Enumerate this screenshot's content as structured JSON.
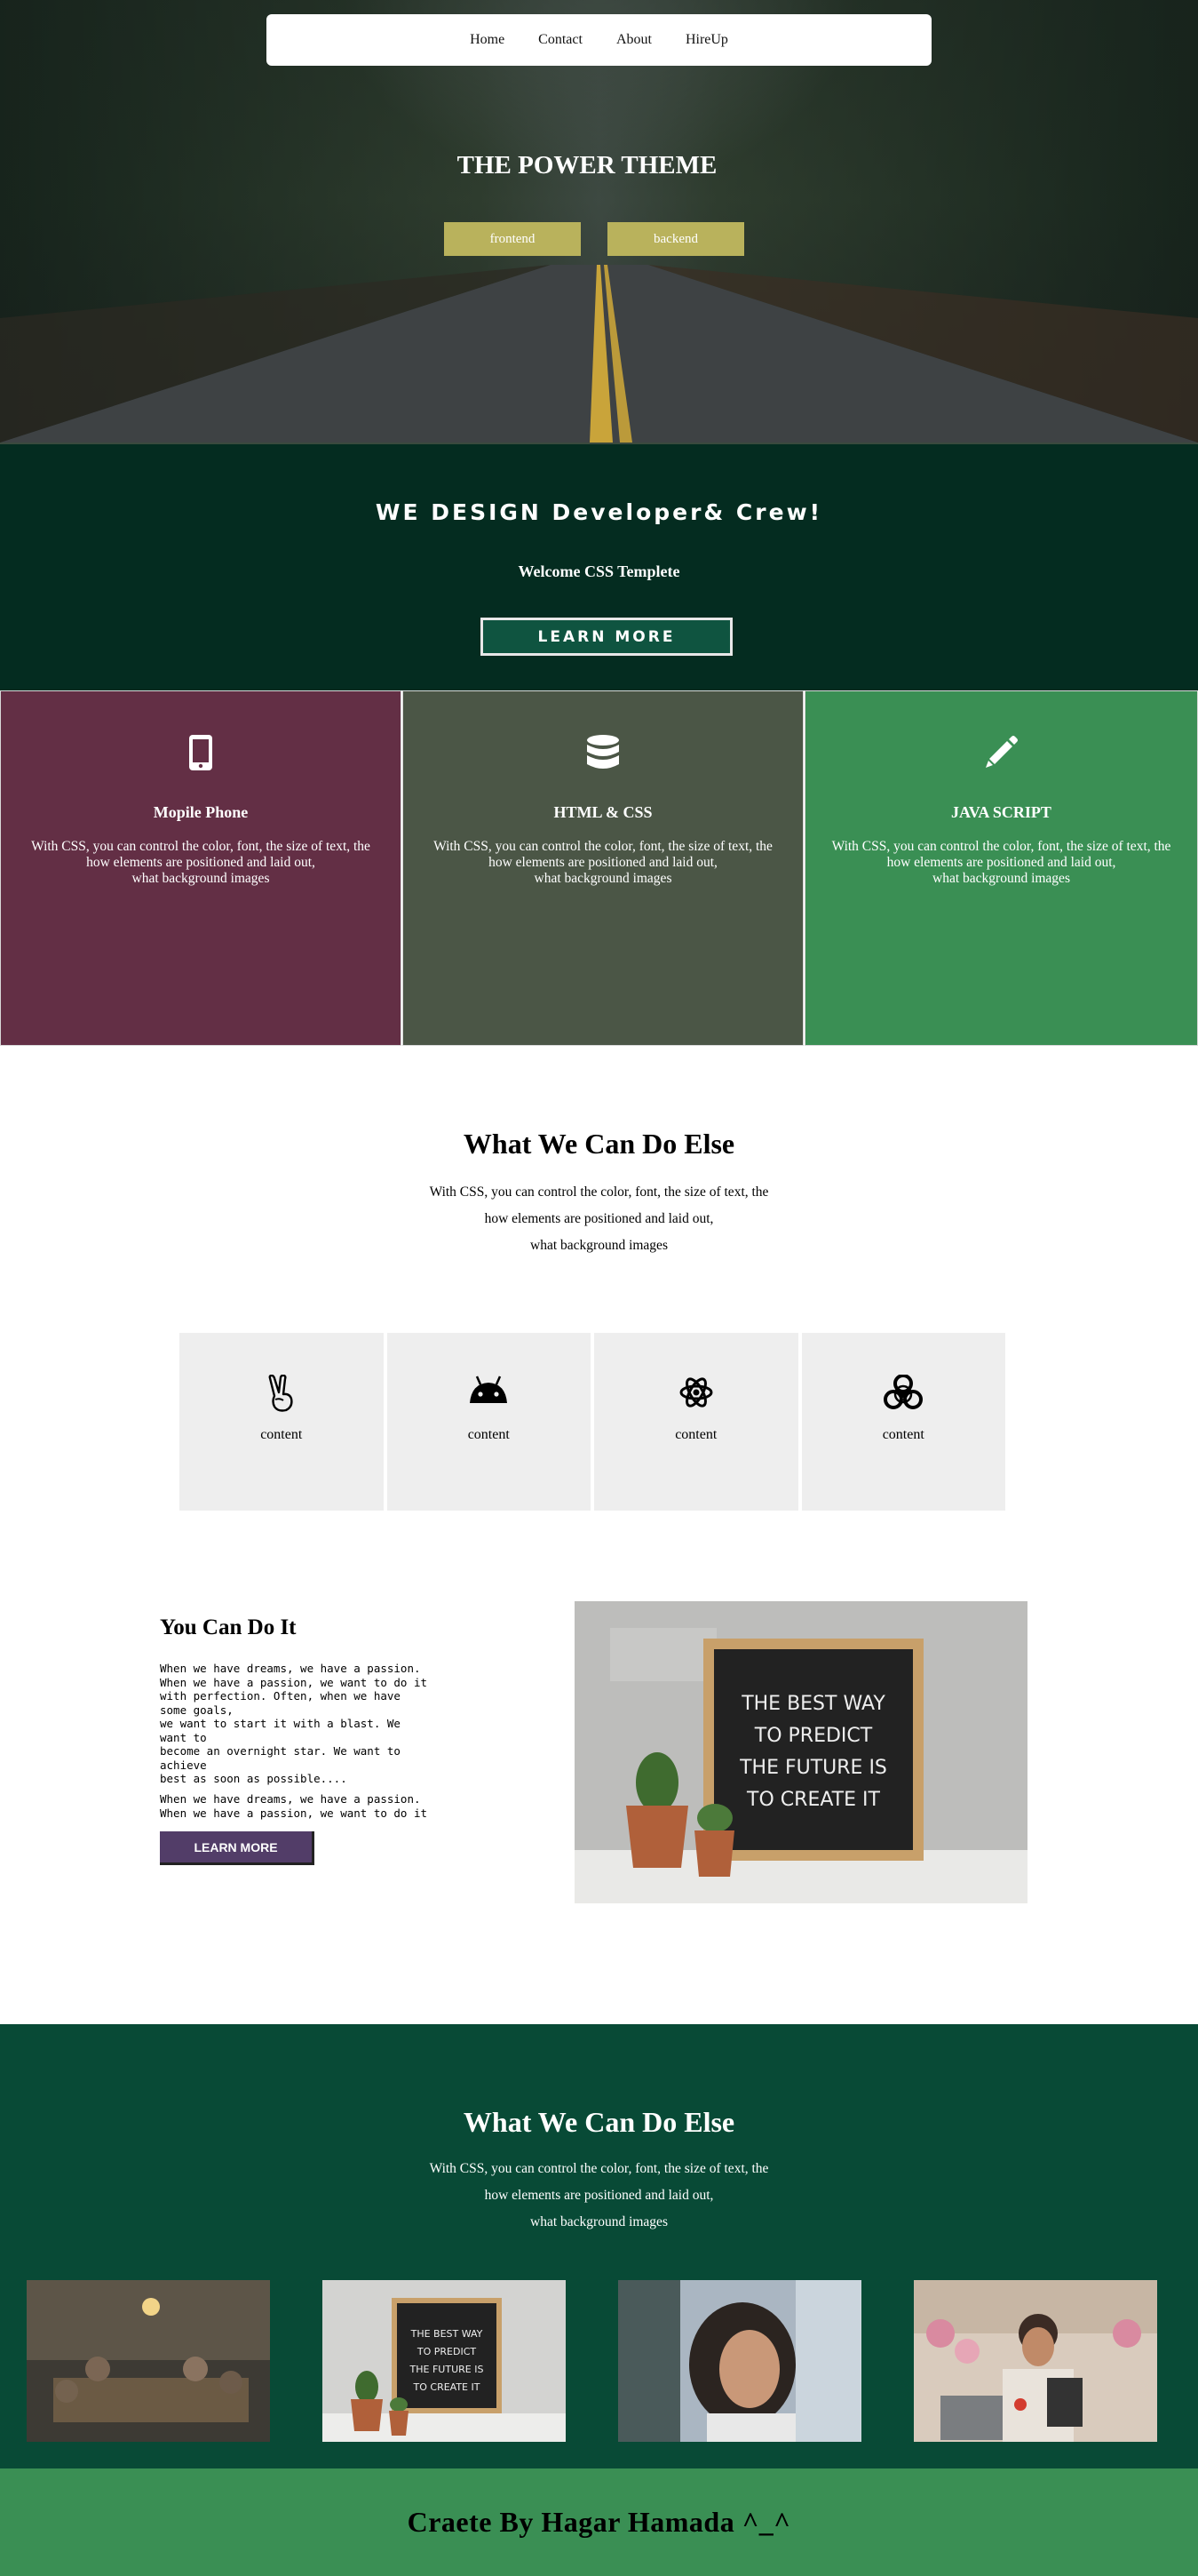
{
  "nav": {
    "items": [
      "Home",
      "Contact",
      "About",
      "HireUp"
    ]
  },
  "hero": {
    "title": "THE POWER THEME",
    "buttons": [
      "frontend",
      "backend"
    ]
  },
  "design": {
    "title": "WE DESIGN Developer& Crew!",
    "subtitle": "Welcome CSS Templete",
    "button": "LEARN MORE"
  },
  "cards": [
    {
      "icon": "mobile-phone-icon",
      "title": "Mopile Phone",
      "bg": "#632f45",
      "text": [
        "With CSS, you can control the color, font, the size of text, the",
        "how elements are positioned and laid out,",
        "what background images"
      ]
    },
    {
      "icon": "database-icon",
      "title": "HTML & CSS",
      "bg": "#4b5646",
      "text": [
        "With CSS, you can control the color, font, the size of text, the",
        "how elements are positioned and laid out,",
        "what background images"
      ]
    },
    {
      "icon": "pencil-icon",
      "title": "JAVA SCRIPT",
      "bg": "#3a8f54",
      "text": [
        "With CSS, you can control the color, font, the size of text, the",
        "how elements are positioned and laid out,",
        "what background images"
      ]
    }
  ],
  "what_we_can_do": {
    "title": "What We Can Do Else",
    "lines": [
      "With CSS, you can control the color, font, the size of text, the",
      "how elements are positioned and laid out,",
      "what background images"
    ]
  },
  "feature_boxes": [
    {
      "icon": "peace-hand-icon",
      "label": "content"
    },
    {
      "icon": "android-icon",
      "label": "content"
    },
    {
      "icon": "atom-icon",
      "label": "content"
    },
    {
      "icon": "biohazard-icon",
      "label": "content"
    }
  ],
  "you_can_do_it": {
    "title": "You Can Do It",
    "paragraph1": "When we have dreams, we have a passion.\nWhen we have a passion, we want to do it\nwith perfection. Often, when we have\nsome goals,\nwe want to start it with a blast. We\nwant to\nbecome an overnight star. We want to\nachieve\nbest as soon as possible....",
    "paragraph2": "When we have dreams, we have a passion.\nWhen we have a passion, we want to do it",
    "button": "LEARN MORE",
    "image_text": [
      "THE BEST WAY",
      "TO PREDICT",
      "THE FUTURE IS",
      "TO CREATE IT"
    ]
  },
  "gallery": {
    "title": "What We Can Do Else",
    "lines": [
      "With CSS, you can control the color, font, the size of text, the",
      "how elements are positioned and laid out,",
      "what background images"
    ],
    "thumb2_text": [
      "THE BEST WAY",
      "TO PREDICT",
      "THE FUTURE IS",
      "TO CREATE IT"
    ]
  },
  "footer": {
    "text": "Craete By Hagar Hamada ^_^"
  },
  "colors": {
    "hero_button": "#b9b25c",
    "design_bg": "#042c20",
    "gallery_bg": "#084a36",
    "footer_bg": "#3a8f54",
    "learn_more_purple": "#523d68"
  }
}
